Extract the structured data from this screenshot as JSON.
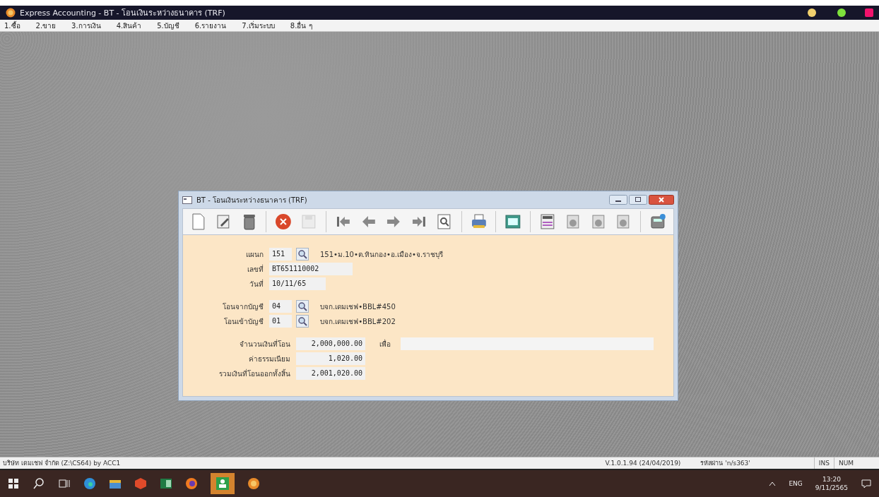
{
  "window": {
    "title": "Express Accounting - BT - โอนเงินระหว่างธนาคาร (TRF)"
  },
  "menu": [
    "1.ซื้อ",
    "2.ขาย",
    "3.การเงิน",
    "4.สินค้า",
    "5.บัญชี",
    "6.รายงาน",
    "7.เริ่มระบบ",
    "8.อื่น ๆ"
  ],
  "dialog": {
    "title": "BT - โอนเงินระหว่างธนาคาร (TRF)",
    "toolbar": [
      {
        "kind": "new",
        "disabled": false
      },
      {
        "kind": "edit",
        "disabled": false
      },
      {
        "kind": "delete",
        "disabled": false
      },
      {
        "kind": "sep"
      },
      {
        "kind": "cancel",
        "disabled": false
      },
      {
        "kind": "save",
        "disabled": true
      },
      {
        "kind": "sep"
      },
      {
        "kind": "first",
        "disabled": false
      },
      {
        "kind": "prev",
        "disabled": false
      },
      {
        "kind": "next",
        "disabled": false
      },
      {
        "kind": "last",
        "disabled": false
      },
      {
        "kind": "find",
        "disabled": false
      },
      {
        "kind": "sep"
      },
      {
        "kind": "print",
        "disabled": false
      },
      {
        "kind": "sep"
      },
      {
        "kind": "sheet",
        "disabled": false
      },
      {
        "kind": "sep"
      },
      {
        "kind": "stamp",
        "disabled": false
      },
      {
        "kind": "ok",
        "disabled": false
      },
      {
        "kind": "ok",
        "disabled": false
      },
      {
        "kind": "ok",
        "disabled": false
      },
      {
        "kind": "sep"
      },
      {
        "kind": "calc",
        "disabled": false
      }
    ],
    "groups": [
      [
        {
          "kind": "lookup",
          "label": "แผนก",
          "value": "151",
          "description": "151•ม.10•ต.หินกอง•อ.เมือง•จ.ราชบุรี"
        },
        {
          "kind": "text",
          "label": "เลขที่",
          "value": "BT651110002"
        },
        {
          "kind": "date",
          "label": "วันที่",
          "value": "10/11/65"
        }
      ],
      [
        {
          "kind": "lookup",
          "label": "โอนจากบัญชี",
          "value": "04",
          "description": "บจก.เดมเชฟ•BBL#450"
        },
        {
          "kind": "lookup",
          "label": "โอนเข้าบัญชี",
          "value": "01",
          "description": "บจก.เดมเชฟ•BBL#202"
        }
      ],
      [
        {
          "kind": "amount",
          "label": "จำนวนเงินที่โอน",
          "value": "2,000,000.00",
          "note": {
            "label": "เพื่อ"
          }
        },
        {
          "kind": "amount",
          "label": "ค่าธรรมเนียม",
          "value": "1,020.00"
        },
        {
          "kind": "amount",
          "label": "รวมเงินที่โอนออกทั้งสิ้น",
          "value": "2,001,020.00"
        }
      ]
    ]
  },
  "status_bar": {
    "company": "บริษัท เดมเชฟ จำกัด (Z:\\CS64) by ACC1",
    "version": "V.1.0.1.94 (24/04/2019)",
    "password": "รหัสผ่าน 'n/s363'",
    "ins": "INS",
    "num": "NUM"
  },
  "taskbar": {
    "language": "ENG",
    "time": "13:20",
    "date": "9/11/2565"
  }
}
